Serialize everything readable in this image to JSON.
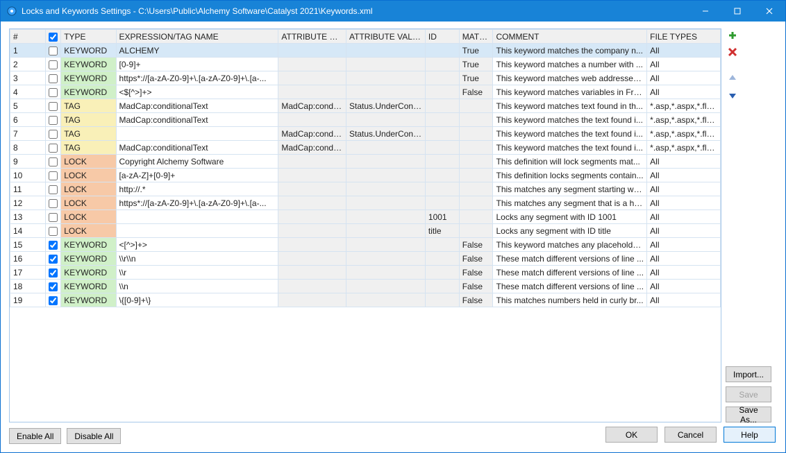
{
  "window_title": "Locks and Keywords Settings - C:\\Users\\Public\\Alchemy Software\\Catalyst 2021\\Keywords.xml",
  "headers": {
    "num": "#",
    "type": "TYPE",
    "expr": "EXPRESSION/TAG NAME",
    "attr_name": "ATTRIBUTE NA...",
    "attr_val": "ATTRIBUTE VALUE",
    "id": "ID",
    "match": "MATC...",
    "comment": "COMMENT",
    "ftypes": "FILE TYPES"
  },
  "rows": [
    {
      "n": "1",
      "chk": false,
      "type": "KEYWORD",
      "tclass": "type-keyword",
      "expr": "ALCHEMY",
      "an": "",
      "av": "",
      "id": "",
      "match": "True",
      "comment": "This keyword matches the company n...",
      "ft": "All",
      "sel": true,
      "shade": false
    },
    {
      "n": "2",
      "chk": false,
      "type": "KEYWORD",
      "tclass": "type-keyword",
      "expr": "[0-9]+",
      "an": "",
      "av": "",
      "id": "",
      "match": "True",
      "comment": "This keyword matches a number with ...",
      "ft": "All",
      "sel": false,
      "shade": true
    },
    {
      "n": "3",
      "chk": false,
      "type": "KEYWORD",
      "tclass": "type-keyword",
      "expr": "https*://[a-zA-Z0-9]+\\.[a-zA-Z0-9]+\\.[a-...",
      "an": "",
      "av": "",
      "id": "",
      "match": "True",
      "comment": "This keyword matches web addresses s...",
      "ft": "All",
      "sel": false,
      "shade": true
    },
    {
      "n": "4",
      "chk": false,
      "type": "KEYWORD",
      "tclass": "type-keyword",
      "expr": "<$[^>]+>",
      "an": "",
      "av": "",
      "id": "",
      "match": "False",
      "comment": "This keyword matches variables in Fra...",
      "ft": "All",
      "sel": false,
      "shade": true
    },
    {
      "n": "5",
      "chk": false,
      "type": "TAG",
      "tclass": "type-tag",
      "expr": "MadCap:conditionalText",
      "an": "MadCap:condit...",
      "av": "Status.UnderConstr...",
      "id": "",
      "match": "",
      "comment": "This keyword matches text found in th...",
      "ft": "*.asp,*.aspx,*.flms...",
      "sel": false,
      "shade": true
    },
    {
      "n": "6",
      "chk": false,
      "type": "TAG",
      "tclass": "type-tag",
      "expr": "MadCap:conditionalText",
      "an": "",
      "av": "",
      "id": "",
      "match": "",
      "comment": "This keyword matches the text found i...",
      "ft": "*.asp,*.aspx,*.flms...",
      "sel": false,
      "shade": true
    },
    {
      "n": "7",
      "chk": false,
      "type": "TAG",
      "tclass": "type-tag",
      "expr": "",
      "an": "MadCap:condit...",
      "av": "Status.UnderConstr...",
      "id": "",
      "match": "",
      "comment": "This keyword matches the text found i...",
      "ft": "*.asp,*.aspx,*.flms...",
      "sel": false,
      "shade": true
    },
    {
      "n": "8",
      "chk": false,
      "type": "TAG",
      "tclass": "type-tag",
      "expr": "MadCap:conditionalText",
      "an": "MadCap:condit...",
      "av": "",
      "id": "",
      "match": "",
      "comment": "This keyword matches the text found i...",
      "ft": "*.asp,*.aspx,*.flms...",
      "sel": false,
      "shade": true
    },
    {
      "n": "9",
      "chk": false,
      "type": "LOCK",
      "tclass": "type-lock",
      "expr": "Copyright Alchemy Software",
      "an": "",
      "av": "",
      "id": "",
      "match": "",
      "comment": " This definition will lock segments mat...",
      "ft": "All",
      "sel": false,
      "shade": true
    },
    {
      "n": "10",
      "chk": false,
      "type": "LOCK",
      "tclass": "type-lock",
      "expr": "[a-zA-Z]+[0-9]+",
      "an": "",
      "av": "",
      "id": "",
      "match": "",
      "comment": "This definition locks segments contain...",
      "ft": "All",
      "sel": false,
      "shade": true
    },
    {
      "n": "11",
      "chk": false,
      "type": "LOCK",
      "tclass": "type-lock",
      "expr": "http://.*",
      "an": "",
      "av": "",
      "id": "",
      "match": "",
      "comment": "This matches any segment starting wit...",
      "ft": "All",
      "sel": false,
      "shade": true
    },
    {
      "n": "12",
      "chk": false,
      "type": "LOCK",
      "tclass": "type-lock",
      "expr": "https*://[a-zA-Z0-9]+\\.[a-zA-Z0-9]+\\.[a-...",
      "an": "",
      "av": "",
      "id": "",
      "match": "",
      "comment": "This matches any segment that is a htt...",
      "ft": "All",
      "sel": false,
      "shade": true
    },
    {
      "n": "13",
      "chk": false,
      "type": "LOCK",
      "tclass": "type-lock",
      "expr": "",
      "an": "",
      "av": "",
      "id": "1001",
      "match": "",
      "comment": "Locks any segment with ID 1001",
      "ft": "All",
      "sel": false,
      "shade": true
    },
    {
      "n": "14",
      "chk": false,
      "type": "LOCK",
      "tclass": "type-lock",
      "expr": "",
      "an": "",
      "av": "",
      "id": "title",
      "match": "",
      "comment": "Locks any segment with ID title",
      "ft": "All",
      "sel": false,
      "shade": true
    },
    {
      "n": "15",
      "chk": true,
      "type": "KEYWORD",
      "tclass": "type-keyword",
      "expr": "<[^>]+>",
      "an": "",
      "av": "",
      "id": "",
      "match": "False",
      "comment": "This keyword matches any placeholder...",
      "ft": "All",
      "sel": false,
      "shade": true
    },
    {
      "n": "16",
      "chk": true,
      "type": "KEYWORD",
      "tclass": "type-keyword",
      "expr": "\\\\r\\\\n",
      "an": "",
      "av": "",
      "id": "",
      "match": "False",
      "comment": "These match different versions of line ...",
      "ft": "All",
      "sel": false,
      "shade": true
    },
    {
      "n": "17",
      "chk": true,
      "type": "KEYWORD",
      "tclass": "type-keyword",
      "expr": "\\\\r",
      "an": "",
      "av": "",
      "id": "",
      "match": "False",
      "comment": "These match different versions of line ...",
      "ft": "All",
      "sel": false,
      "shade": true
    },
    {
      "n": "18",
      "chk": true,
      "type": "KEYWORD",
      "tclass": "type-keyword",
      "expr": "\\\\n",
      "an": "",
      "av": "",
      "id": "",
      "match": "False",
      "comment": "These match different versions of line ...",
      "ft": "All",
      "sel": false,
      "shade": true
    },
    {
      "n": "19",
      "chk": true,
      "type": "KEYWORD",
      "tclass": "type-keyword",
      "expr": "\\{[0-9]+\\}",
      "an": "",
      "av": "",
      "id": "",
      "match": "False",
      "comment": "This matches numbers held in curly br...",
      "ft": "All",
      "sel": false,
      "shade": true
    }
  ],
  "buttons": {
    "import": "Import...",
    "save": "Save",
    "saveas": "Save As...",
    "enable_all": "Enable All",
    "disable_all": "Disable All",
    "ok": "OK",
    "cancel": "Cancel",
    "help": "Help"
  }
}
